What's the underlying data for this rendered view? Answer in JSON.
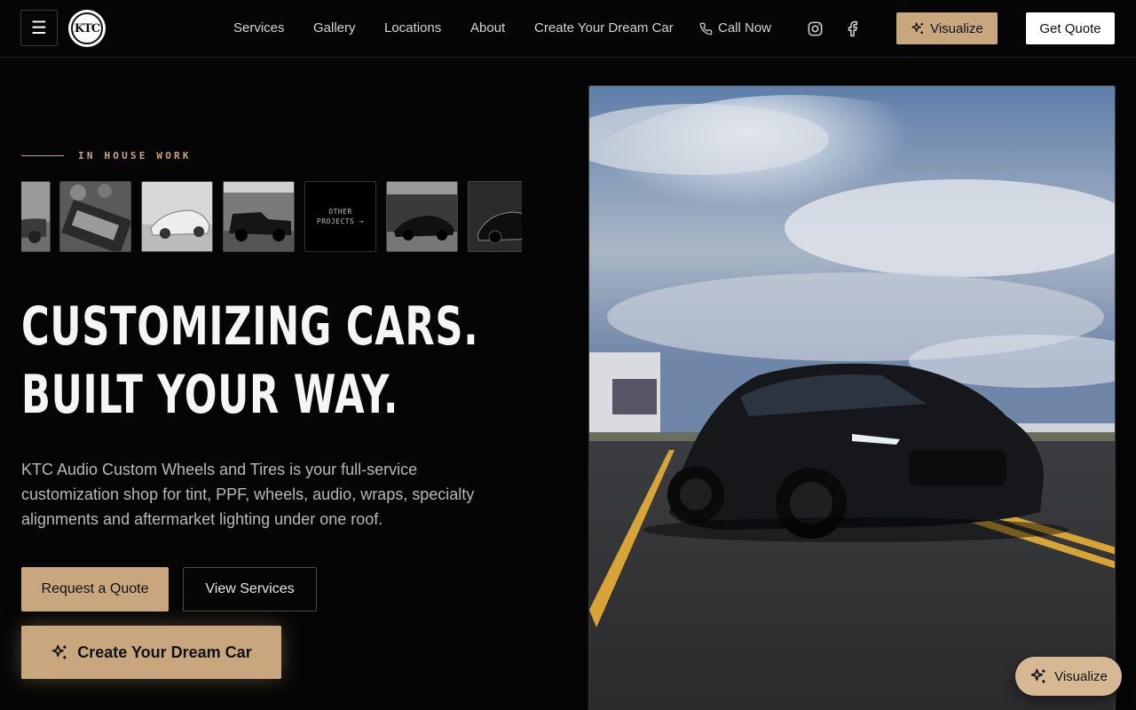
{
  "header": {
    "menu_icon": "hamburger-icon",
    "logo_text": "KTC",
    "nav": [
      {
        "label": "Services"
      },
      {
        "label": "Gallery"
      },
      {
        "label": "Locations"
      },
      {
        "label": "About"
      },
      {
        "label": "Create Your Dream Car"
      },
      {
        "label": "Call Now",
        "icon": "phone-icon"
      }
    ],
    "social": [
      {
        "icon": "instagram-icon"
      },
      {
        "icon": "facebook-icon"
      }
    ],
    "visualize_label": "Visualize",
    "quote_label": "Get Quote"
  },
  "hero": {
    "eyebrow": "IN HOUSE WORK",
    "other_projects_line1": "OTHER",
    "other_projects_line2": "PROJECTS →",
    "headline_line1": "CUSTOMIZING CARS.",
    "headline_line2": "BUILT YOUR WAY.",
    "description": "KTC Audio Custom Wheels and Tires is your full-service customization shop for tint, PPF, wheels, audio, wraps, specialty alignments and aftermarket lighting under one roof.",
    "request_label": "Request a Quote",
    "services_label": "View Services",
    "dream_label": "Create Your Dream Car"
  },
  "floating": {
    "visualize_label": "Visualize"
  },
  "colors": {
    "accent": "#c9a77e",
    "background": "#050505"
  }
}
